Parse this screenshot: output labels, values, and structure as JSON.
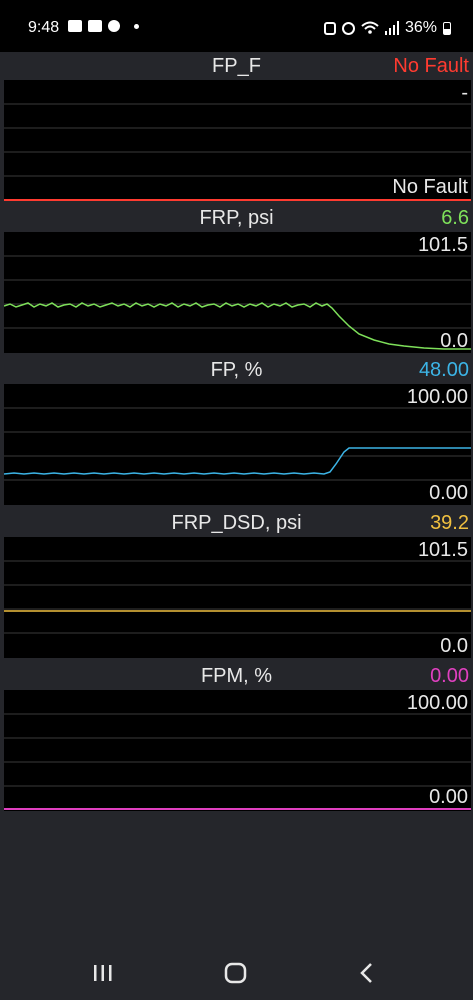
{
  "status_bar": {
    "time": "9:48",
    "battery": "36%",
    "icons_left": [
      "chat-icon",
      "gallery-icon",
      "accessibility-icon"
    ],
    "icons_right": [
      "lock-icon",
      "alarm-icon",
      "wifi-icon",
      "signal-icon",
      "battery-icon"
    ]
  },
  "panels": [
    {
      "title": "FP_F",
      "value": "No Fault",
      "value_color": "#ff3b30",
      "top_label": "-",
      "bottom_label": "No Fault",
      "line_color": "#ff3b30"
    },
    {
      "title": "FRP, psi",
      "value": "6.6",
      "value_color": "#7ee05a",
      "top_label": "101.5",
      "bottom_label": "0.0",
      "line_color": "#7ee05a"
    },
    {
      "title": "FP, %",
      "value": "48.00",
      "value_color": "#3cb4e6",
      "top_label": "100.00",
      "bottom_label": "0.00",
      "line_color": "#3cb4e6"
    },
    {
      "title": "FRP_DSD, psi",
      "value": "39.2",
      "value_color": "#f0c040",
      "top_label": "101.5",
      "bottom_label": "0.0",
      "line_color": "#f0c040"
    },
    {
      "title": "FPM, %",
      "value": "0.00",
      "value_color": "#e040c0",
      "top_label": "100.00",
      "bottom_label": "0.00",
      "line_color": "#e040c0"
    }
  ],
  "nav": {
    "recent": "recent-apps-icon",
    "home": "home-icon",
    "back": "back-icon"
  }
}
